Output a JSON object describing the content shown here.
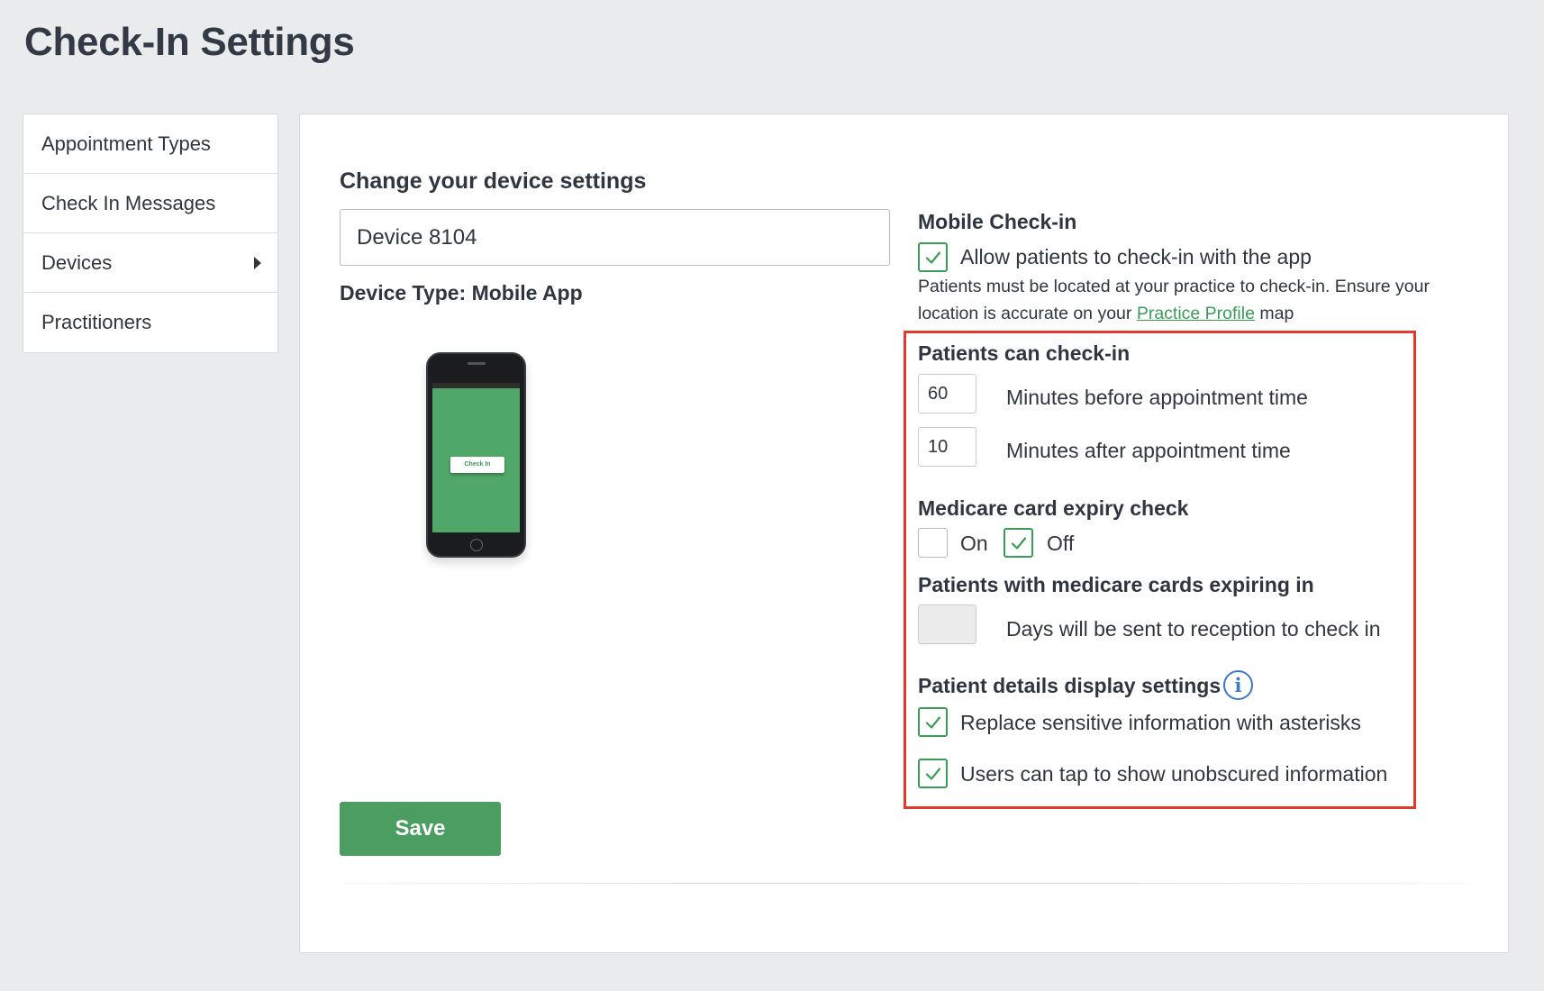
{
  "page": {
    "title": "Check-In Settings"
  },
  "sidebar": {
    "items": [
      {
        "label": "Appointment Types"
      },
      {
        "label": "Check In Messages"
      },
      {
        "label": "Devices"
      },
      {
        "label": "Practitioners"
      }
    ]
  },
  "device": {
    "section_title": "Change your device settings",
    "name_value": "Device 8104",
    "type_label": "Device Type: Mobile App",
    "phone_button_label": "Check In"
  },
  "mobile_checkin": {
    "title": "Mobile Check-in",
    "allow_label": "Allow patients to check-in with the app",
    "allow_checked": true,
    "note_prefix": "Patients must be located at your practice to check-in. Ensure your location is accurate on your",
    "note_link": "Practice Profile",
    "note_suffix": "map"
  },
  "patients_checkin": {
    "title": "Patients can check-in",
    "before_value": "60",
    "before_label": "Minutes before appointment time",
    "after_value": "10",
    "after_label": "Minutes after appointment time"
  },
  "medicare": {
    "title": "Medicare card expiry check",
    "on_label": "On",
    "on_checked": false,
    "off_label": "Off",
    "off_checked": true,
    "expiring_title": "Patients with medicare cards expiring in",
    "days_value": "",
    "days_label": "Days will be sent to reception to check in"
  },
  "display_settings": {
    "title": "Patient details display settings",
    "asterisks_label": "Replace sensitive information with asterisks",
    "asterisks_checked": true,
    "tap_label": "Users can tap to show unobscured information",
    "tap_checked": true
  },
  "actions": {
    "save_label": "Save"
  },
  "colors": {
    "accent_green": "#4b9d61",
    "highlight_red": "#e03a2c",
    "info_blue": "#3c78c9"
  }
}
